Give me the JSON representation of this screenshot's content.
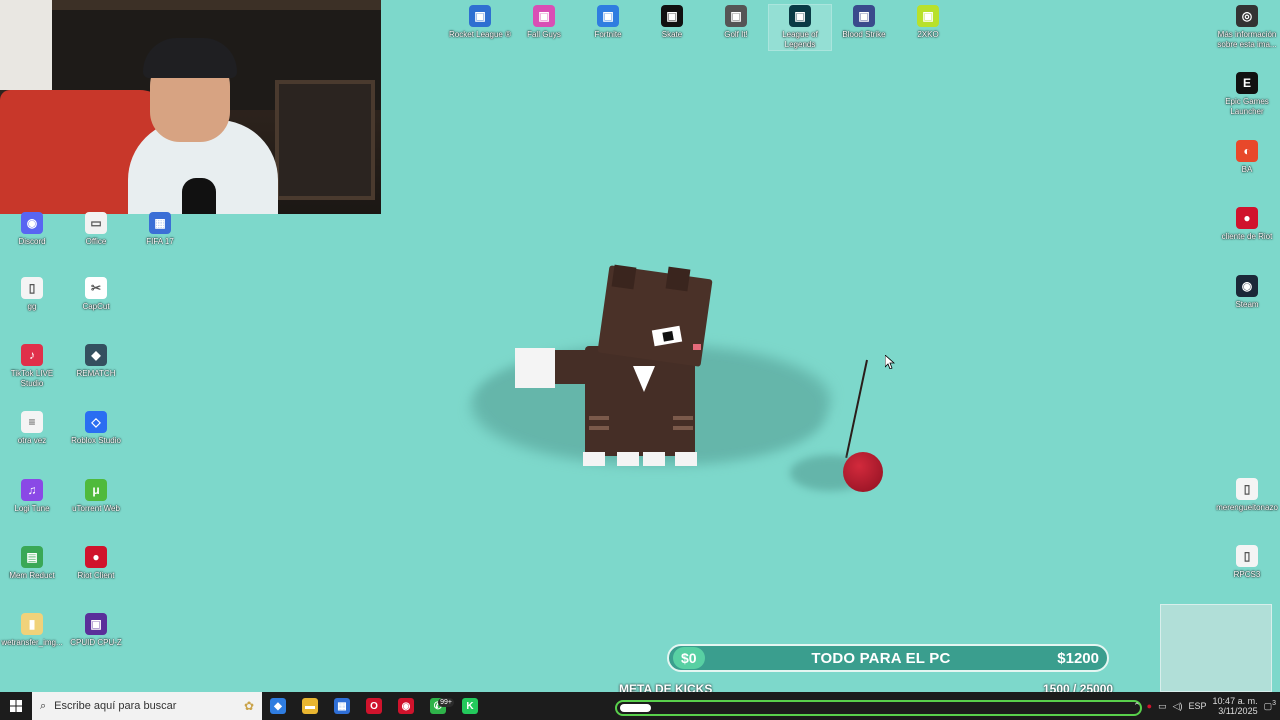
{
  "desktop": {
    "top_icons": [
      {
        "label": "Rocket League ®",
        "icon": "rocket-league-icon",
        "color": "#2e6fd1"
      },
      {
        "label": "Fall Guys",
        "icon": "fall-guys-icon",
        "color": "#d94fb5"
      },
      {
        "label": "Fortnite",
        "icon": "fortnite-icon",
        "color": "#2f7de0"
      },
      {
        "label": "Skate",
        "icon": "skate-icon",
        "color": "#111111"
      },
      {
        "label": "Golf It!",
        "icon": "golf-it-icon",
        "color": "#555555"
      },
      {
        "label": "League of Legends",
        "icon": "league-of-legends-icon",
        "color": "#0a3a45"
      },
      {
        "label": "Blood Strike",
        "icon": "blood-strike-icon",
        "color": "#3a4b8c"
      },
      {
        "label": "2XKO",
        "icon": "2xko-icon",
        "color": "#b8e12b"
      }
    ],
    "left_icons": [
      {
        "label": "Discord",
        "icon": "discord-icon",
        "color": "#5865f2",
        "glyph": "◉"
      },
      {
        "label": "Office",
        "icon": "office-icon",
        "color": "#f2f2f2",
        "glyph": "▭"
      },
      {
        "label": "FIFA 17",
        "icon": "fifa-17-icon",
        "color": "#3b6fd6",
        "glyph": "▦"
      },
      {
        "label": "gg",
        "icon": "document-icon",
        "color": "#f4f4f4",
        "glyph": "▯"
      },
      {
        "label": "CapCut",
        "icon": "capcut-icon",
        "color": "#ffffff",
        "glyph": "✂"
      },
      {
        "label": "TikTok LIVE Studio",
        "icon": "tiktok-live-studio-icon",
        "color": "#e0304a",
        "glyph": "♪"
      },
      {
        "label": "REMATCH",
        "icon": "rematch-icon",
        "color": "#34505f",
        "glyph": "◆"
      },
      {
        "label": "otra vez",
        "icon": "text-file-icon",
        "color": "#f4f4f4",
        "glyph": "≡"
      },
      {
        "label": "Roblox Studio",
        "icon": "roblox-studio-icon",
        "color": "#2a6ef2",
        "glyph": "◇"
      },
      {
        "label": "Logi Tune",
        "icon": "logi-tune-icon",
        "color": "#8a49e6",
        "glyph": "♫"
      },
      {
        "label": "uTorrent Web",
        "icon": "utorrent-web-icon",
        "color": "#4fba3c",
        "glyph": "μ"
      },
      {
        "label": "Mem Reduct",
        "icon": "mem-reduct-icon",
        "color": "#3aa856",
        "glyph": "▤"
      },
      {
        "label": "Riot Client",
        "icon": "riot-client-icon",
        "color": "#d0132c",
        "glyph": "●"
      },
      {
        "label": "wetransfer_img...",
        "icon": "zip-folder-icon",
        "color": "#f0d27a",
        "glyph": "▮"
      },
      {
        "label": "CPUID CPU-Z",
        "icon": "cpu-z-icon",
        "color": "#5a2f9a",
        "glyph": "▣"
      }
    ],
    "right_icons": [
      {
        "label": "Más información sobre esta ima...",
        "icon": "camera-info-icon",
        "color": "#333333",
        "glyph": "◎"
      },
      {
        "label": "Epic Games Launcher",
        "icon": "epic-games-icon",
        "color": "#111111",
        "glyph": "E"
      },
      {
        "label": "BA",
        "icon": "ba-icon",
        "color": "#e8482a",
        "glyph": "◐"
      },
      {
        "label": "cliente de Riot",
        "icon": "riot-client-icon",
        "color": "#d0132c",
        "glyph": "●"
      },
      {
        "label": "Steam",
        "icon": "steam-icon",
        "color": "#1b2838",
        "glyph": "◉"
      },
      {
        "label": "merengueitonazo",
        "icon": "document-icon",
        "color": "#f4f4f4",
        "glyph": "▯"
      },
      {
        "label": "RPCS3",
        "icon": "rpcs3-icon",
        "color": "#f4f4f4",
        "glyph": "▯"
      }
    ]
  },
  "goal": {
    "current": "$0",
    "title": "TODO PARA EL PC",
    "target": "$1200",
    "accent": "#58d0a3"
  },
  "kicks": {
    "label": "META DE KICKS",
    "count": "1500  / 25000",
    "progress": 0.06,
    "bar_color": "#59d04c"
  },
  "taskbar": {
    "search_placeholder": "Escribe aquí para buscar",
    "apps": [
      {
        "icon": "copilot-icon",
        "color": "#2f7de0",
        "glyph": "◆"
      },
      {
        "icon": "file-explorer-icon",
        "color": "#e8b530",
        "glyph": "▬"
      },
      {
        "icon": "microsoft-store-icon",
        "color": "#2f6fd6",
        "glyph": "▦"
      },
      {
        "icon": "opera-icon",
        "color": "#d0132c",
        "glyph": "O"
      },
      {
        "icon": "aim-icon",
        "color": "#d0132c",
        "glyph": "◉"
      },
      {
        "icon": "whatsapp-icon",
        "color": "#2fb34a",
        "glyph": "✆"
      },
      {
        "icon": "kick-icon",
        "color": "#23c95c",
        "glyph": "K"
      }
    ],
    "whatsapp_badge": "99+",
    "tray_lang": "ESP",
    "time": "10:47 a. m.",
    "date": "3/11/2025",
    "notif_count": "3"
  }
}
